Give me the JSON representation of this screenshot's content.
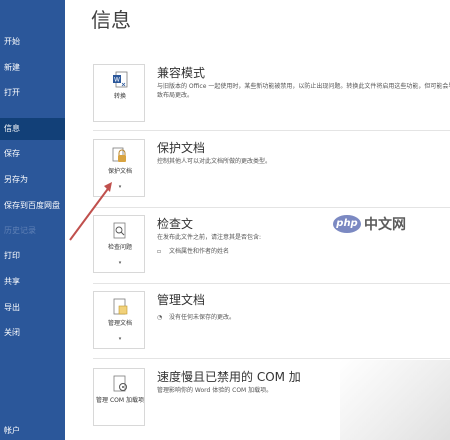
{
  "sidebar": {
    "items": [
      {
        "label": "开始"
      },
      {
        "label": "新建"
      },
      {
        "label": "打开"
      },
      {
        "label": "信息"
      },
      {
        "label": "保存"
      },
      {
        "label": "另存为"
      },
      {
        "label": "保存到百度网盘"
      },
      {
        "label": "历史记录"
      },
      {
        "label": "打印"
      },
      {
        "label": "共享"
      },
      {
        "label": "导出"
      },
      {
        "label": "关闭"
      },
      {
        "label": "帐户"
      }
    ],
    "active_index": 3
  },
  "main": {
    "title": "信息",
    "sections": {
      "compat": {
        "tile_label": "转换",
        "title": "兼容模式",
        "desc": "与旧版本的 Office 一起使用时，某些新功能被禁用，以防止出现问题。转换此文件将启用这些功能，但可能会导致布局更改。"
      },
      "protect": {
        "tile_label": "保护文档",
        "title": "保护文档",
        "desc": "控制其他人可以对此文档所做的更改类型。"
      },
      "inspect": {
        "tile_label": "检查问题",
        "title": "检查文",
        "desc": "在发布此文件之前，请注意其是否包含:",
        "bullet": "文档属性和作者的姓名"
      },
      "manage": {
        "tile_label": "管理文档",
        "title": "管理文档",
        "desc": "没有任何未保存的更改。"
      },
      "com": {
        "tile_label": "管理 COM 加载项",
        "title": "速度慢且已禁用的 COM 加",
        "desc": "管理影响你的 Word 体验的 COM 加载项。"
      }
    }
  },
  "watermark": {
    "logo": "php",
    "text": "中文网"
  },
  "colors": {
    "sidebar": "#2b579a",
    "sidebar_active": "#124078",
    "arrow": "#c0504d",
    "word_blue": "#2b579a",
    "lock_gold": "#d9a441"
  }
}
